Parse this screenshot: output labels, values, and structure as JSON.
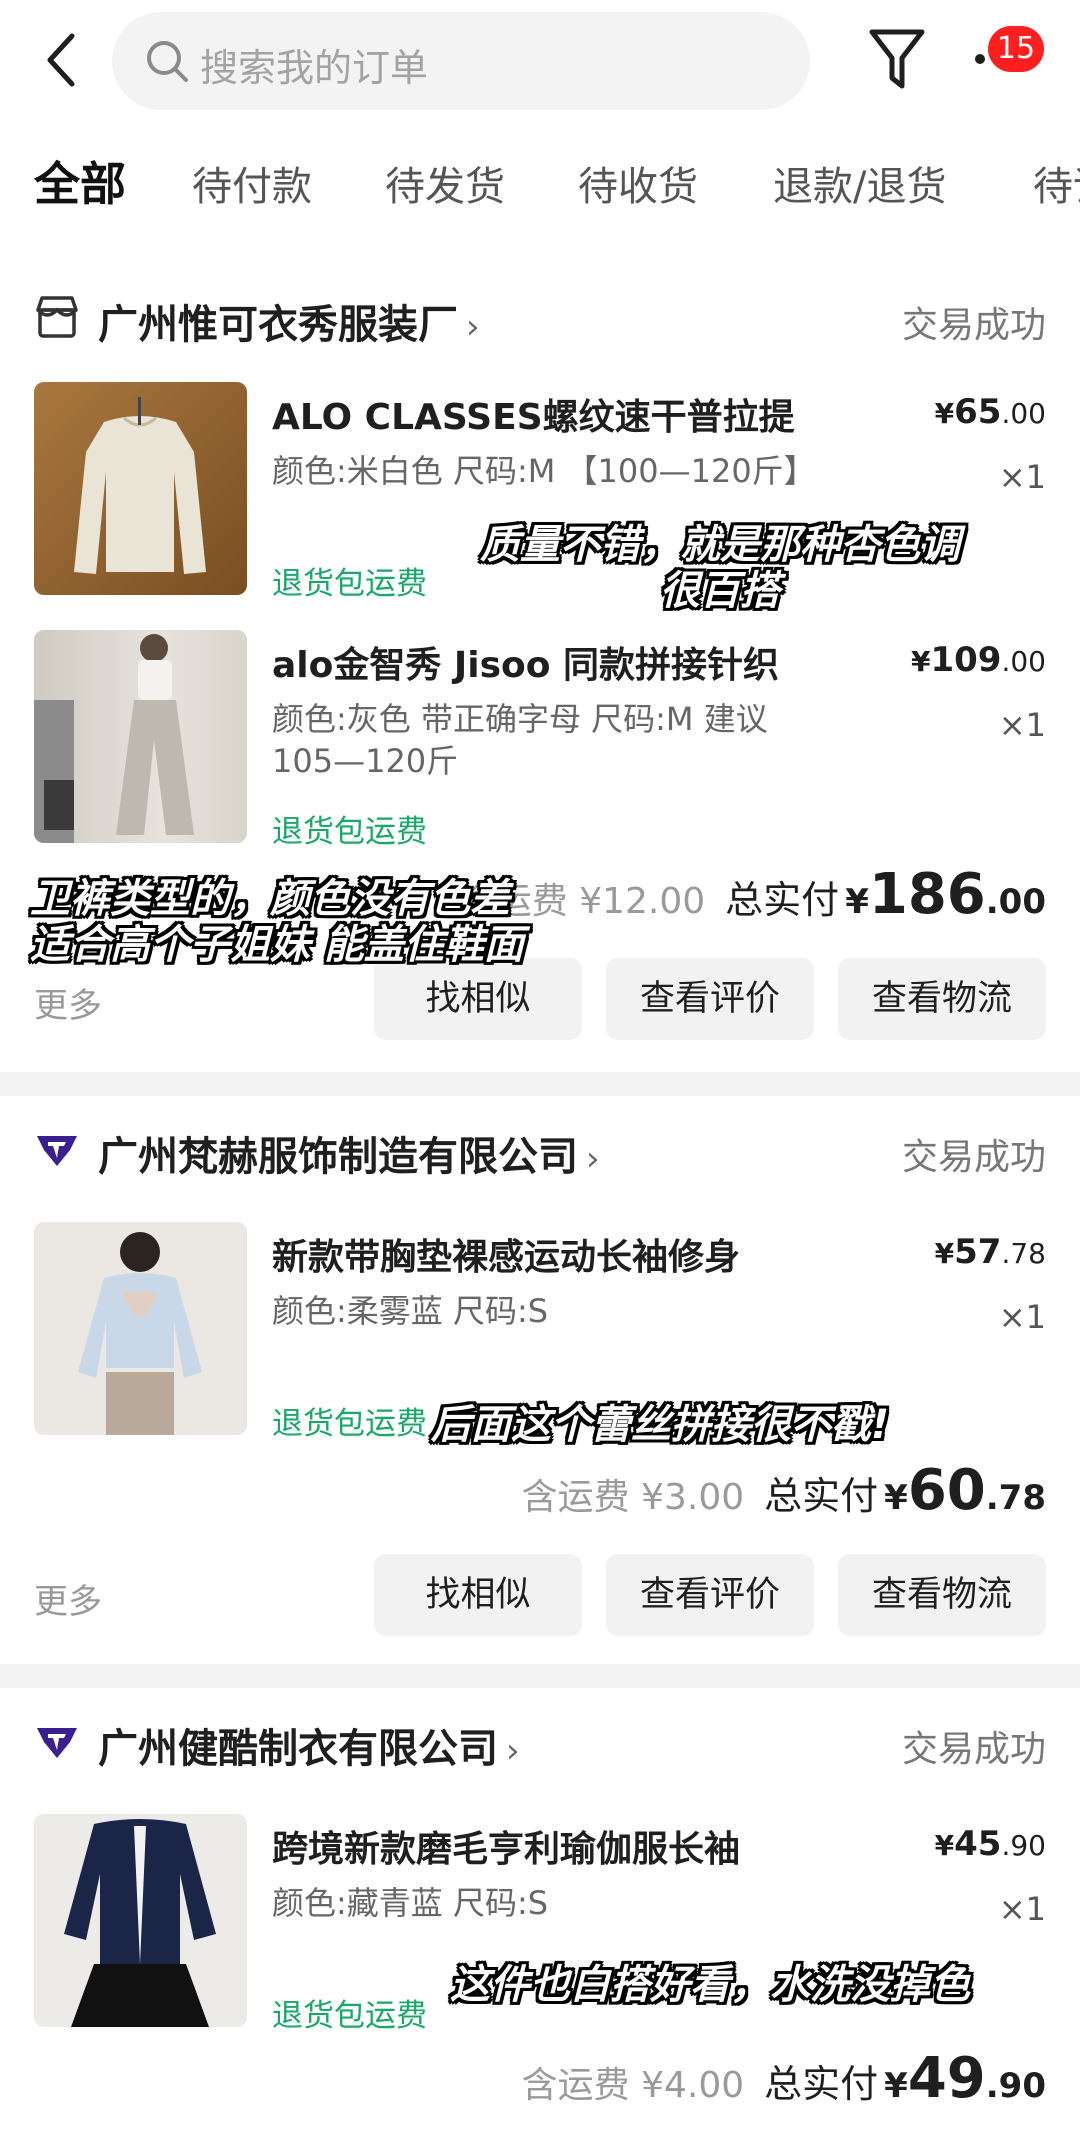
{
  "header": {
    "search_placeholder": "搜索我的订单",
    "notification_count": "15"
  },
  "tabs": [
    {
      "label": "全部",
      "active": true
    },
    {
      "label": "待付款"
    },
    {
      "label": "待发货"
    },
    {
      "label": "待收货"
    },
    {
      "label": "退款/退货"
    },
    {
      "label": "待评价"
    }
  ],
  "orders": [
    {
      "shop": "广州惟可衣秀服装厂",
      "shop_icon": "store-icon",
      "status": "交易成功",
      "items": [
        {
          "title": "ALO CLASSES螺纹速干普拉提",
          "spec": "颜色:米白色 尺码:M 【100—120斤】",
          "tag": "退货包运费",
          "price_int": "65",
          "price_dec": ".00",
          "qty": "×1"
        },
        {
          "title": "alo金智秀 Jisoo 同款拼接针织",
          "spec": "颜色:灰色 带正确字母 尺码:M 建议105—120斤",
          "tag": "退货包运费",
          "price_int": "109",
          "price_dec": ".00",
          "qty": "×1"
        }
      ],
      "shipping": "含运费 ¥12.00",
      "total_label": "总实付",
      "total_int": "186",
      "total_dec": ".00",
      "more": "更多",
      "buttons": [
        "找相似",
        "查看评价",
        "查看物流"
      ]
    },
    {
      "shop": "广州梵赫服饰制造有限公司",
      "shop_icon": "tmall-brand-icon",
      "status": "交易成功",
      "items": [
        {
          "title": "新款带胸垫裸感运动长袖修身",
          "spec": "颜色:柔雾蓝 尺码:S",
          "tag": "退货包运费",
          "price_int": "57",
          "price_dec": ".78",
          "qty": "×1"
        }
      ],
      "shipping": "含运费 ¥3.00",
      "total_label": "总实付",
      "total_int": "60",
      "total_dec": ".78",
      "more": "更多",
      "buttons": [
        "找相似",
        "查看评价",
        "查看物流"
      ]
    },
    {
      "shop": "广州健酷制衣有限公司",
      "shop_icon": "tmall-brand-icon",
      "status": "交易成功",
      "items": [
        {
          "title": "跨境新款磨毛亨利瑜伽服长袖",
          "spec": "颜色:藏青蓝 尺码:S",
          "tag": "退货包运费",
          "price_int": "45",
          "price_dec": ".90",
          "qty": "×1"
        }
      ],
      "shipping": "含运费 ¥4.00",
      "total_label": "总实付",
      "total_int": "49",
      "total_dec": ".90"
    }
  ],
  "currency": "¥",
  "captions": {
    "c1_line1": "质量不错，就是那种杏色调",
    "c1_line2": "很百搭",
    "c2_line1": "卫裤类型的，颜色没有色差",
    "c2_line2": "适合高个子姐妹 能盖住鞋面",
    "c3": "后面这个蕾丝拼接很不戳!",
    "c4": "这件也白搭好看，水洗没掉色"
  }
}
